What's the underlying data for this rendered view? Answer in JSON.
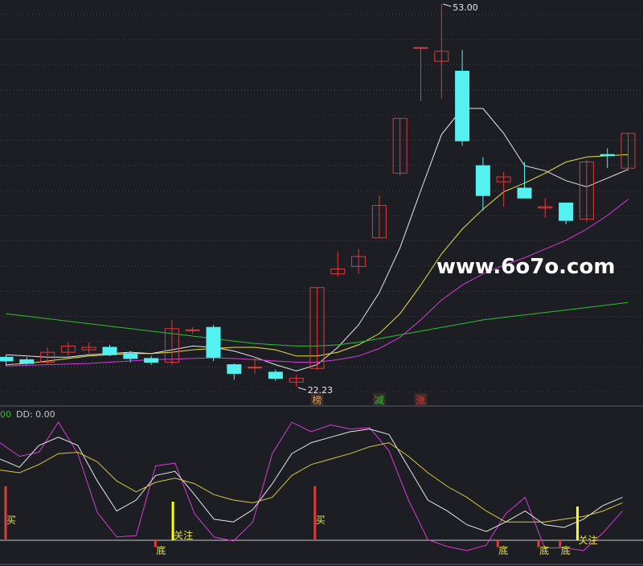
{
  "watermark": "www.6o7o.com",
  "colors": {
    "background": "#1c1e24",
    "grid": "#3a3f4a",
    "up": "#e03a3a",
    "down": "#55f0f0",
    "ma_white": "#e8e8e8",
    "ma_yellow": "#e8e04a",
    "ma_magenta": "#d83ad8",
    "ma_green": "#2cc02c",
    "sub_white": "#e8e8e8",
    "sub_yellow": "#d8c83a",
    "sub_magenta": "#d83ad8"
  },
  "chart_data": [
    {
      "type": "candlestick",
      "annotations": {
        "high_label": "53.00",
        "low_label": "22.23"
      },
      "tags": [
        {
          "index": 15,
          "text": "榜",
          "color": "#e8a040"
        },
        {
          "index": 18,
          "text": "减",
          "color": "#2cc02c"
        },
        {
          "index": 20,
          "text": "涨",
          "color": "#e03a3a"
        }
      ],
      "candles": [
        {
          "o": 24.6,
          "h": 24.8,
          "l": 23.9,
          "c": 24.3
        },
        {
          "o": 24.4,
          "h": 24.6,
          "l": 24.0,
          "c": 24.1
        },
        {
          "o": 24.2,
          "h": 25.4,
          "l": 24.0,
          "c": 25.0
        },
        {
          "o": 25.0,
          "h": 25.8,
          "l": 24.7,
          "c": 25.5
        },
        {
          "o": 25.2,
          "h": 25.8,
          "l": 24.9,
          "c": 25.4
        },
        {
          "o": 25.4,
          "h": 25.6,
          "l": 24.7,
          "c": 24.8
        },
        {
          "o": 24.9,
          "h": 25.1,
          "l": 24.2,
          "c": 24.5
        },
        {
          "o": 24.5,
          "h": 24.7,
          "l": 24.0,
          "c": 24.2
        },
        {
          "o": 24.2,
          "h": 27.6,
          "l": 24.0,
          "c": 26.9
        },
        {
          "o": 26.8,
          "h": 27.0,
          "l": 26.5,
          "c": 26.8
        },
        {
          "o": 27.0,
          "h": 27.2,
          "l": 24.3,
          "c": 24.6
        },
        {
          "o": 24.0,
          "h": 24.1,
          "l": 22.8,
          "c": 23.3
        },
        {
          "o": 23.8,
          "h": 24.6,
          "l": 23.3,
          "c": 23.8
        },
        {
          "o": 23.4,
          "h": 23.6,
          "l": 22.7,
          "c": 22.9
        },
        {
          "o": 22.6,
          "h": 23.2,
          "l": 22.23,
          "c": 22.9
        },
        {
          "o": 23.7,
          "h": 30.2,
          "l": 23.6,
          "c": 30.2
        },
        {
          "o": 31.3,
          "h": 33.1,
          "l": 31.1,
          "c": 31.7
        },
        {
          "o": 31.9,
          "h": 33.3,
          "l": 31.3,
          "c": 32.7
        },
        {
          "o": 34.2,
          "h": 37.6,
          "l": 34.2,
          "c": 36.8
        },
        {
          "o": 39.4,
          "h": 43.8,
          "l": 39.2,
          "c": 43.8
        },
        {
          "o": 49.5,
          "h": 49.5,
          "l": 45.2,
          "c": 49.5
        },
        {
          "o": 48.4,
          "h": 53.0,
          "l": 45.4,
          "c": 49.2
        },
        {
          "o": 47.6,
          "h": 49.3,
          "l": 41.6,
          "c": 42.0
        },
        {
          "o": 40.0,
          "h": 40.7,
          "l": 36.4,
          "c": 37.6
        },
        {
          "o": 38.7,
          "h": 39.5,
          "l": 36.7,
          "c": 39.1
        },
        {
          "o": 38.2,
          "h": 40.3,
          "l": 37.5,
          "c": 37.4
        },
        {
          "o": 36.6,
          "h": 37.4,
          "l": 35.8,
          "c": 36.7
        },
        {
          "o": 37.0,
          "h": 37.0,
          "l": 35.3,
          "c": 35.6
        },
        {
          "o": 35.7,
          "h": 40.5,
          "l": 35.5,
          "c": 40.3
        },
        {
          "o": 40.9,
          "h": 41.4,
          "l": 39.8,
          "c": 40.8
        },
        {
          "o": 39.8,
          "h": 42.6,
          "l": 39.6,
          "c": 42.6
        }
      ],
      "ma_lines": [
        {
          "color_key": "ma_white",
          "values": [
            24.8,
            24.7,
            24.6,
            24.6,
            24.8,
            24.9,
            25.0,
            24.9,
            25.2,
            25.5,
            25.4,
            25.1,
            24.6,
            24.0,
            23.5,
            24.0,
            25.4,
            27.2,
            29.8,
            33.4,
            38.0,
            42.5,
            44.6,
            44.6,
            42.6,
            40.0,
            39.6,
            38.8,
            38.3,
            39.0,
            39.7
          ]
        },
        {
          "color_key": "ma_yellow",
          "values": [
            24.0,
            24.1,
            24.3,
            24.5,
            24.7,
            24.8,
            24.9,
            24.9,
            25.0,
            25.2,
            25.3,
            25.4,
            25.4,
            25.2,
            24.7,
            24.7,
            25.0,
            25.6,
            26.5,
            28.1,
            30.4,
            32.9,
            34.9,
            36.5,
            37.9,
            38.6,
            39.4,
            40.3,
            40.7,
            40.8,
            40.9
          ]
        },
        {
          "color_key": "ma_magenta",
          "values": [
            23.9,
            23.95,
            24.0,
            24.05,
            24.1,
            24.2,
            24.3,
            24.4,
            24.45,
            24.5,
            24.55,
            24.5,
            24.4,
            24.3,
            24.2,
            24.2,
            24.4,
            24.7,
            25.3,
            26.2,
            27.6,
            29.2,
            30.4,
            31.3,
            32.0,
            32.6,
            33.3,
            34.0,
            34.9,
            36.0,
            37.3
          ]
        },
        {
          "color_key": "ma_green",
          "values": [
            28.1,
            27.9,
            27.7,
            27.5,
            27.3,
            27.1,
            26.9,
            26.7,
            26.5,
            26.3,
            26.1,
            25.9,
            25.7,
            25.6,
            25.5,
            25.5,
            25.6,
            25.8,
            26.1,
            26.4,
            26.7,
            27.0,
            27.3,
            27.6,
            27.8,
            28.0,
            28.2,
            28.4,
            28.6,
            28.8,
            29.0
          ]
        }
      ]
    },
    {
      "type": "line",
      "header": {
        "left_text": "00",
        "dd_label": "DD: 0.00"
      },
      "y_range": [
        0,
        100
      ],
      "series": [
        {
          "color_key": "sub_magenta",
          "values": [
            82,
            72,
            75,
            97,
            74,
            31,
            13,
            14,
            65,
            67,
            30,
            13,
            10,
            24,
            74,
            97,
            90,
            95,
            92,
            93,
            76,
            40,
            11,
            6,
            3,
            7,
            30,
            42,
            5,
            5,
            3,
            16,
            32
          ]
        },
        {
          "color_key": "sub_white",
          "values": [
            70,
            64,
            80,
            86,
            80,
            54,
            32,
            40,
            58,
            61,
            44,
            26,
            24,
            33,
            52,
            74,
            82,
            86,
            90,
            92,
            88,
            64,
            40,
            32,
            22,
            17,
            24,
            32,
            22,
            20,
            26,
            36,
            42
          ]
        },
        {
          "color_key": "sub_yellow",
          "values": [
            62,
            60,
            66,
            74,
            75,
            68,
            54,
            46,
            53,
            56,
            52,
            44,
            40,
            38,
            42,
            58,
            66,
            70,
            74,
            79,
            82,
            72,
            60,
            50,
            42,
            32,
            24,
            24,
            24,
            26,
            28,
            32,
            38
          ]
        }
      ],
      "signals": [
        {
          "index": 0,
          "text": "买",
          "bar_color": "#e03a3a",
          "text_color": "#e8e04a",
          "direction": "up",
          "height": 0.56
        },
        {
          "index": 7.7,
          "text": "底",
          "bar_color": "#e03a3a",
          "text_color": "#e8e04a",
          "direction": "down",
          "height": 0.12
        },
        {
          "index": 8.6,
          "text": "关注",
          "bar_color": "#ffff00",
          "text_color": "#e8e04a",
          "direction": "up",
          "height": 0.4
        },
        {
          "index": 15.9,
          "text": "买",
          "bar_color": "#e03a3a",
          "text_color": "#e8e04a",
          "direction": "up",
          "height": 0.56
        },
        {
          "index": 25.3,
          "text": "底",
          "bar_color": "#e03a3a",
          "text_color": "#e8e04a",
          "direction": "down",
          "height": 0.12
        },
        {
          "index": 27.4,
          "text": "底",
          "bar_color": "#e03a3a",
          "text_color": "#e8e04a",
          "direction": "down",
          "height": 0.12
        },
        {
          "index": 28.5,
          "text": "底",
          "bar_color": "#e03a3a",
          "text_color": "#e8e04a",
          "direction": "down",
          "height": 0.12
        },
        {
          "index": 29.4,
          "text": "关注",
          "bar_color": "#ffff00",
          "text_color": "#e8e04a",
          "direction": "up",
          "height": 0.35
        }
      ]
    }
  ]
}
